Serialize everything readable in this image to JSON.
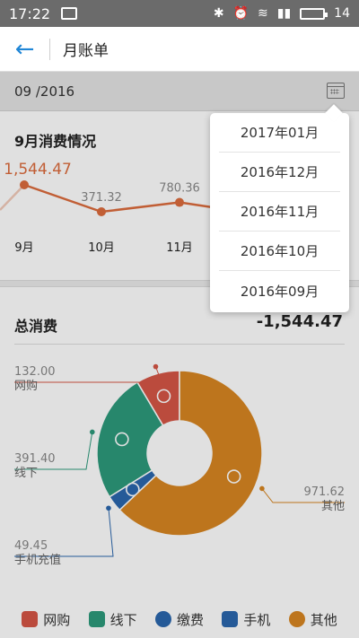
{
  "status_bar": {
    "time": "17:22",
    "battery_level": "14"
  },
  "header": {
    "title": "月账单"
  },
  "date_selector": {
    "value": "09 /2016"
  },
  "monthly_summary": {
    "title": "9月消费情况"
  },
  "total": {
    "label": "总消费",
    "value": "-1,544.47"
  },
  "month_menu": {
    "options": [
      "2017年01月",
      "2016年12月",
      "2016年11月",
      "2016年10月",
      "2016年09月"
    ]
  },
  "legend": [
    {
      "label": "网购",
      "color": "#d55646",
      "icon": "shopping-bag-icon"
    },
    {
      "label": "线下",
      "color": "#2d9a7c",
      "icon": "store-icon"
    },
    {
      "label": "缴费",
      "color": "#2b67ad",
      "icon": "water-drop-icon"
    },
    {
      "label": "手机",
      "color": "#2b67ad",
      "icon": "phone-icon"
    },
    {
      "label": "其他",
      "color": "#d88621",
      "icon": "more-icon"
    }
  ],
  "chart_data": [
    {
      "type": "line",
      "categories": [
        "9月",
        "10月",
        "11月"
      ],
      "values": [
        1544.47,
        371.32,
        780.36
      ],
      "data_labels": [
        "1,544.47",
        "371.32",
        "780.36"
      ],
      "color": "#dc6c3d"
    },
    {
      "type": "pie",
      "categories": [
        "网购",
        "线下",
        "手机充值",
        "其他"
      ],
      "values": [
        132.0,
        391.4,
        49.45,
        971.62
      ],
      "value_labels": [
        "132.00",
        "391.40",
        "49.45",
        "971.62"
      ],
      "colors": [
        "#d55646",
        "#2d9a7c",
        "#2b67ad",
        "#d88621"
      ]
    }
  ]
}
